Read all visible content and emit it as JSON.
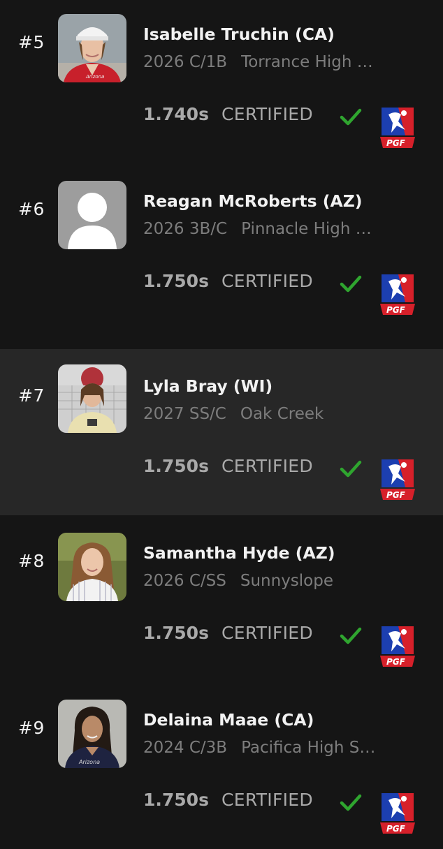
{
  "rows": [
    {
      "rank": "#5",
      "name": "Isabelle Truchin (CA)",
      "class_pos": "2026 C/1B",
      "school": "Torrance High …",
      "time": "1.740s",
      "status": "CERTIFIED",
      "photo": "player-photo",
      "logo": "PGF"
    },
    {
      "rank": "#6",
      "name": "Reagan McRoberts (AZ)",
      "class_pos": "2026 3B/C",
      "school": "Pinnacle High …",
      "time": "1.750s",
      "status": "CERTIFIED",
      "photo": "default-avatar",
      "logo": "PGF"
    },
    {
      "rank": "#7",
      "name": "Lyla Bray (WI)",
      "class_pos": "2027 SS/C",
      "school": "Oak Creek",
      "time": "1.750s",
      "status": "CERTIFIED",
      "photo": "player-photo",
      "logo": "PGF"
    },
    {
      "rank": "#8",
      "name": "Samantha Hyde (AZ)",
      "class_pos": "2026 C/SS",
      "school": "Sunnyslope",
      "time": "1.750s",
      "status": "CERTIFIED",
      "photo": "player-photo",
      "logo": "PGF"
    },
    {
      "rank": "#9",
      "name": "Delaina Maae (CA)",
      "class_pos": "2024 C/3B",
      "school": "Pacifica High S…",
      "time": "1.750s",
      "status": "CERTIFIED",
      "photo": "player-photo",
      "logo": "PGF"
    }
  ],
  "colors": {
    "background": "#151515",
    "highlight_row": "#272727",
    "check": "#2fa52f",
    "logo_blue": "#1c3fb0",
    "logo_red": "#d6202a"
  }
}
